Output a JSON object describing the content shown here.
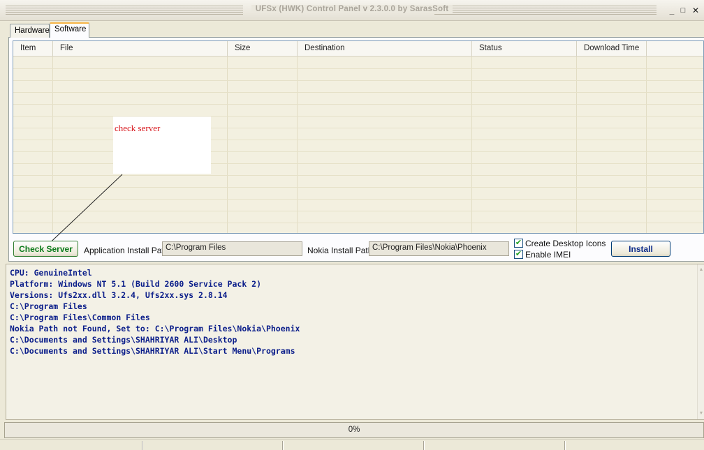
{
  "window": {
    "title": "UFSx (HWK) Control Panel v 2.3.0.0 by SarasSoft",
    "minimize_glyph": "_",
    "maximize_glyph": "□",
    "close_glyph": "✕"
  },
  "tabs": [
    {
      "label": "Hardware",
      "active": false
    },
    {
      "label": "Software",
      "active": true
    }
  ],
  "grid": {
    "columns": [
      "Item",
      "File",
      "Size",
      "Destination",
      "Status",
      "Download Time"
    ],
    "rows": []
  },
  "annotation": {
    "text": "check server",
    "color": "#d8191f"
  },
  "controls": {
    "check_server_label": "Check Server",
    "app_path_label": "Application Install Path",
    "app_path_value": "C:\\Program Files",
    "nokia_path_label": "Nokia Install Path",
    "nokia_path_value": "C:\\Program Files\\Nokia\\Phoenix",
    "create_icons_label": "Create Desktop Icons",
    "create_icons_checked": true,
    "enable_imei_label": "Enable IMEI",
    "enable_imei_checked": true,
    "install_label": "Install"
  },
  "log": {
    "lines": [
      "CPU: GenuineIntel",
      "Platform: Windows NT 5.1 (Build 2600 Service Pack 2)",
      "Versions: Ufs2xx.dll 3.2.4, Ufs2xx.sys 2.8.14",
      "C:\\Program Files",
      "C:\\Program Files\\Common Files",
      "Nokia Path not Found, Set to: C:\\Program Files\\Nokia\\Phoenix",
      "C:\\Documents and Settings\\SHAHRIYAR ALI\\Desktop",
      "C:\\Documents and Settings\\SHAHRIYAR ALI\\Start Menu\\Programs"
    ],
    "color": "#0b1e8a"
  },
  "progress": {
    "label": "0%",
    "value": 0
  },
  "colors": {
    "accent_button_text": "#0a7a1a",
    "install_text": "#0b2a8a",
    "checkmark": "#21a121"
  }
}
